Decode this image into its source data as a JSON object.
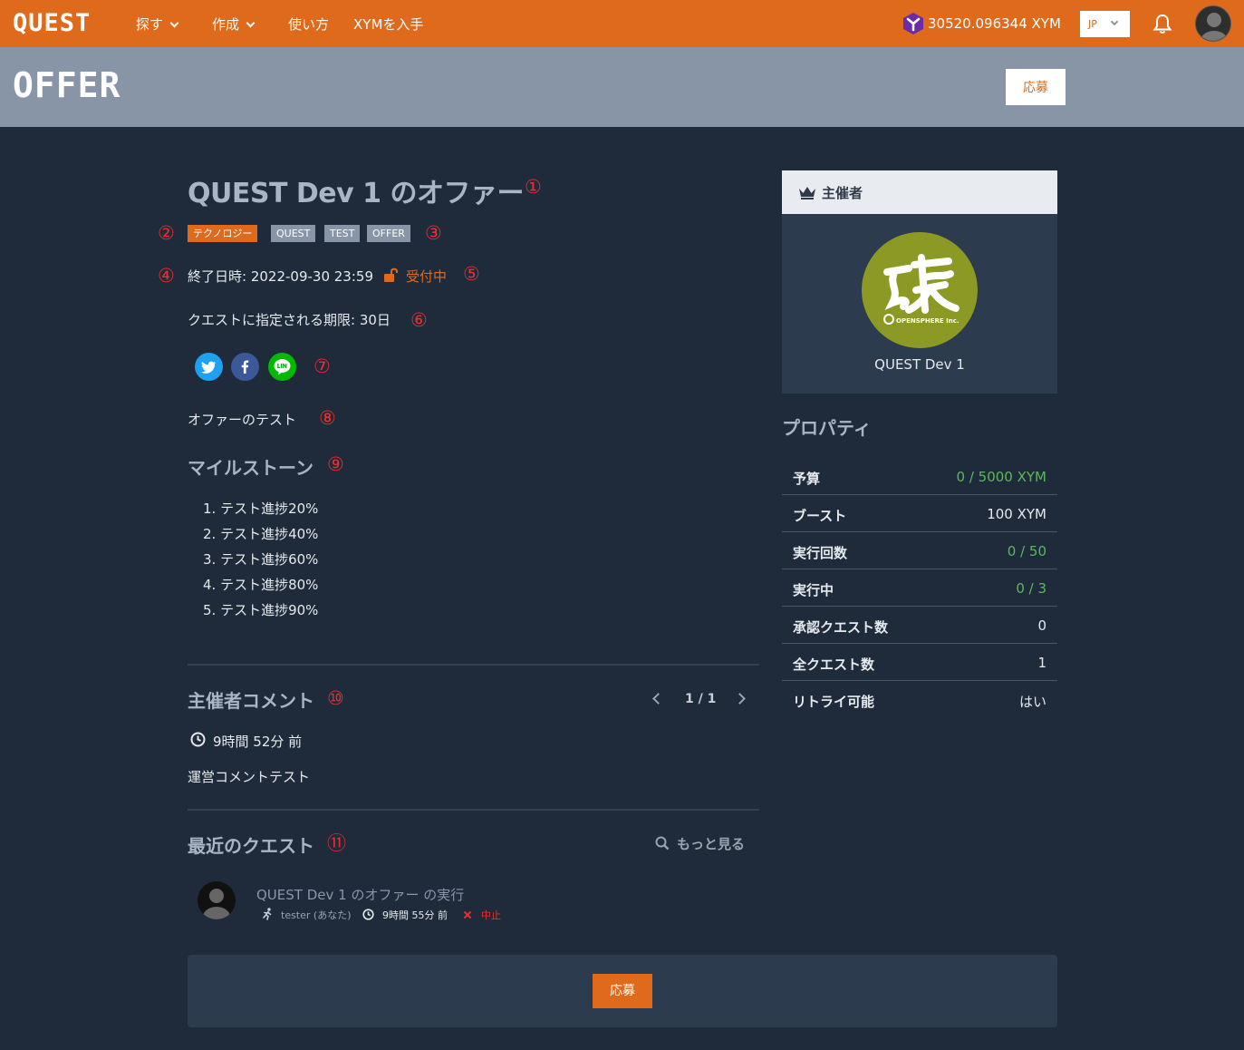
{
  "nav": {
    "logo": "QUEST",
    "explore": "探す",
    "create": "作成",
    "howto": "使い方",
    "get_xym": "XYMを入手",
    "balance": "30520.096344 XYM",
    "lang": "JP"
  },
  "banner": {
    "title": "OFFER",
    "apply": "応募"
  },
  "offer": {
    "title": "QUEST Dev 1 のオファー",
    "tags": [
      "テクノロジー",
      "QUEST",
      "TEST",
      "OFFER"
    ],
    "end_date": "終了日時: 2022-09-30 23:59",
    "status": "受付中",
    "deadline": "クエストに指定される期限: 30日",
    "description": "オファーのテスト",
    "milestones_title": "マイルストーン",
    "milestones": [
      "1. テスト進捗20%",
      "2. テスト進捗40%",
      "3. テスト進捗60%",
      "4. テスト進捗80%",
      "5. テスト進捗90%"
    ]
  },
  "annotations": [
    "①",
    "②",
    "③",
    "④",
    "⑤",
    "⑥",
    "⑦",
    "⑧",
    "⑨",
    "⑩",
    "⑪"
  ],
  "comments": {
    "title": "主催者コメント",
    "page": "1 / 1",
    "time": "9時間 52分 前",
    "body": "運営コメントテスト"
  },
  "recent": {
    "title": "最近のクエスト",
    "more": "もっと見る",
    "item": {
      "title": "QUEST Dev 1 のオファー の実行",
      "user": "tester (あなた)",
      "time": "9時間 55分 前",
      "state": "中止"
    }
  },
  "apply_button": "応募",
  "organizer": {
    "header": "主催者",
    "name": "QUEST Dev 1",
    "logo_text": "OPENSPHERE Inc."
  },
  "properties": {
    "title": "プロパティ",
    "rows": [
      {
        "key": "予算",
        "value": "0 / 5000 XYM"
      },
      {
        "key": "ブースト",
        "value": "100 XYM"
      },
      {
        "key": "実行回数",
        "value": "0 / 50"
      },
      {
        "key": "実行中",
        "value": "0 / 3"
      },
      {
        "key": "承認クエスト数",
        "value": "0"
      },
      {
        "key": "全クエスト数",
        "value": "1"
      },
      {
        "key": "リトライ可能",
        "value": "はい"
      }
    ]
  },
  "colors": {
    "brand": "#e06a1c",
    "background": "#1f2b3a",
    "success": "#5cb85c",
    "danger": "#e8302d"
  }
}
